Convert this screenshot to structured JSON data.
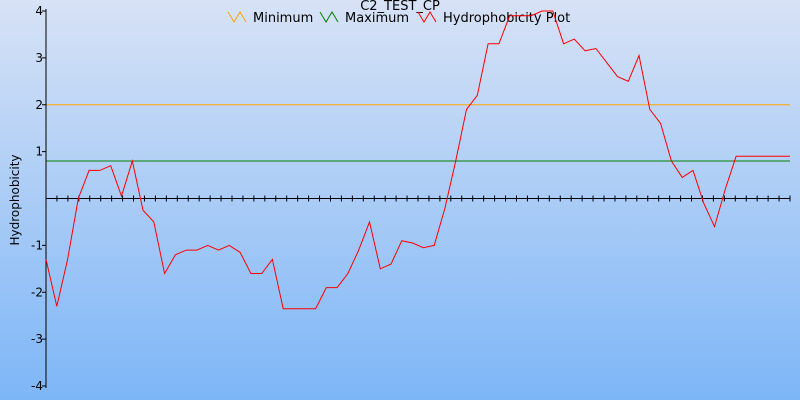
{
  "chart_data": {
    "type": "line",
    "title": "C2_TEST_CP",
    "xlabel": "",
    "ylabel": "Hydrophobicity",
    "ylim": [
      -4,
      4
    ],
    "yticks": [
      4,
      3,
      2,
      1,
      -1,
      -2,
      -3,
      -4
    ],
    "legend_position": "top-center",
    "legend": [
      "Minimum",
      "Maximum",
      "Hydrophobicity Plot"
    ],
    "thresholds": [
      {
        "name": "Minimum",
        "value": 2.0,
        "color": "#ffa500"
      },
      {
        "name": "Maximum",
        "value": 0.8,
        "color": "#008000"
      }
    ],
    "series": [
      {
        "name": "Hydrophobicity Plot",
        "color": "#ff0000",
        "x": [
          1,
          2,
          3,
          4,
          5,
          6,
          7,
          8,
          9,
          10,
          11,
          12,
          13,
          14,
          15,
          16,
          17,
          18,
          19,
          20,
          21,
          22,
          23,
          24,
          25,
          26,
          27,
          28,
          29,
          30,
          31,
          32,
          33,
          34,
          35,
          36,
          37,
          38,
          39,
          40,
          41,
          42,
          43,
          44,
          45,
          46,
          47,
          48,
          49,
          50,
          51,
          52,
          53,
          54,
          55,
          56,
          57,
          58,
          59,
          60,
          61,
          62,
          63,
          64,
          65,
          66,
          67,
          68,
          69,
          70
        ],
        "values": [
          -1.3,
          -2.3,
          -1.3,
          0.0,
          0.6,
          0.6,
          0.7,
          0.05,
          0.8,
          -0.25,
          -0.5,
          -1.6,
          -1.2,
          -1.1,
          -1.1,
          -1.0,
          -1.1,
          -1.0,
          -1.15,
          -1.6,
          -1.6,
          -1.3,
          -2.35,
          -2.35,
          -2.35,
          -2.35,
          -1.9,
          -1.9,
          -1.6,
          -1.1,
          -0.5,
          -1.5,
          -1.4,
          -0.9,
          -0.95,
          -1.05,
          -1.0,
          -0.2,
          0.8,
          1.9,
          2.2,
          3.3,
          3.3,
          3.9,
          3.9,
          3.9,
          4.0,
          4.0,
          3.3,
          3.4,
          3.15,
          3.2,
          2.9,
          2.6,
          2.5,
          3.05,
          1.9,
          1.6,
          0.8,
          0.45,
          0.6,
          -0.1,
          -0.6,
          0.2,
          0.9,
          0.9,
          0.9,
          0.9,
          0.9,
          0.9
        ]
      }
    ],
    "x_tick_count": 68,
    "grid": false
  }
}
